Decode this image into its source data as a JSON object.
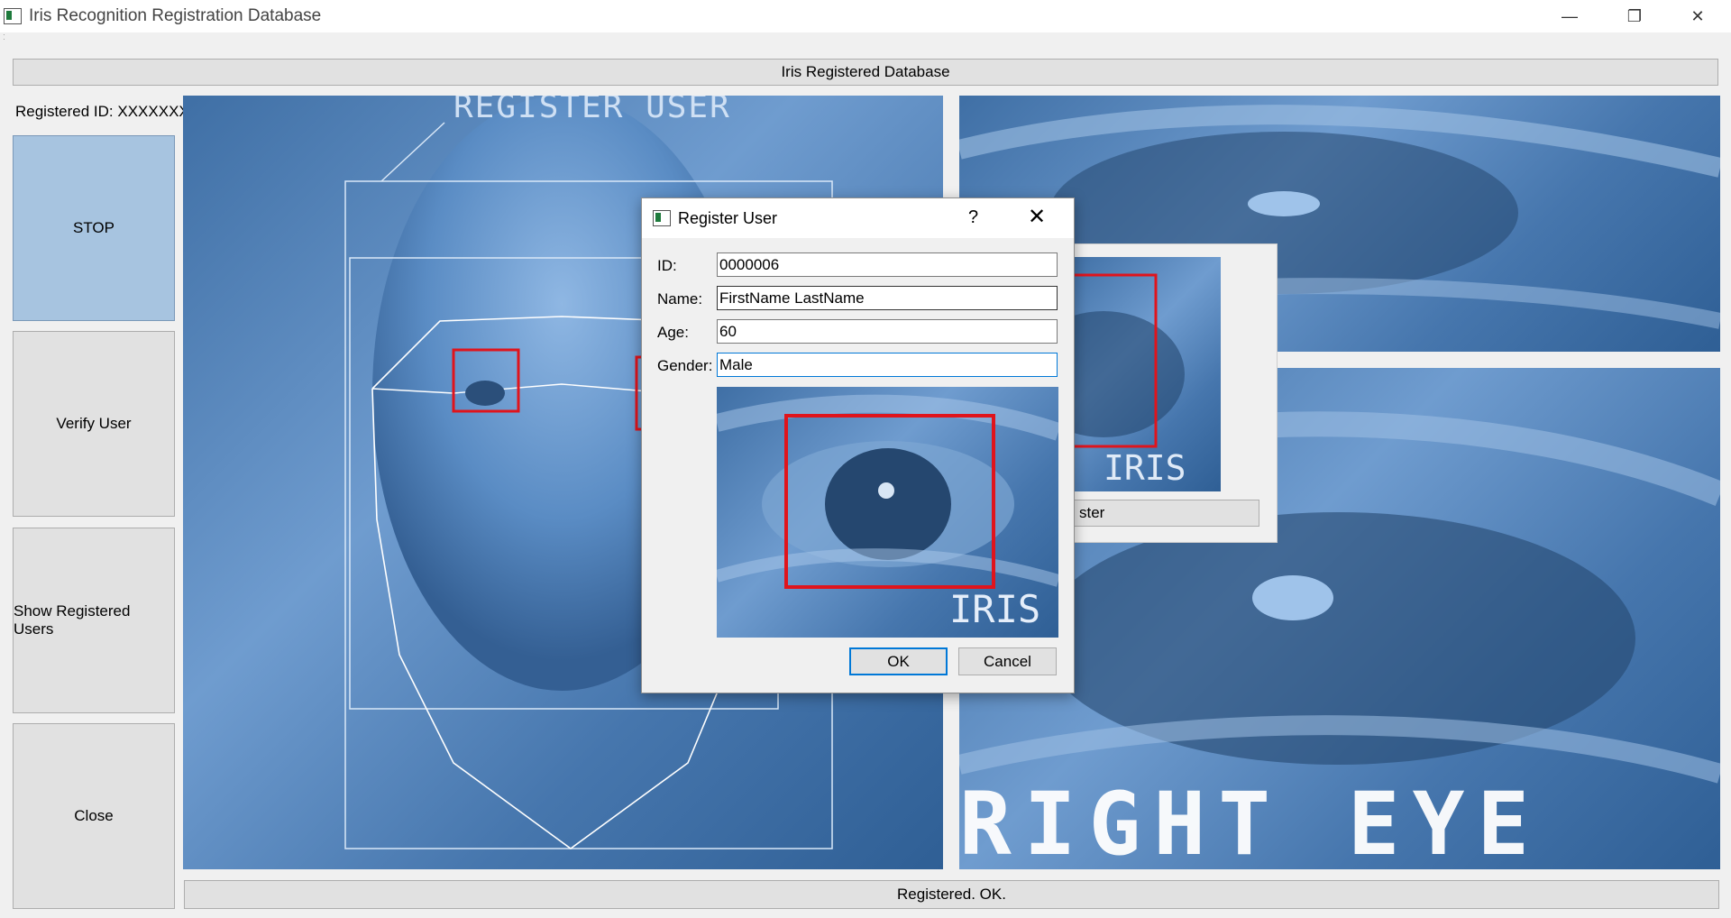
{
  "window": {
    "title": "Iris Recognition Registration Database",
    "minimize_glyph": "—",
    "maximize_glyph": "❐",
    "close_glyph": "✕"
  },
  "header_button": "Iris Registered Database",
  "registered_id_label": "Registered ID: XXXXXXX",
  "sidebar": {
    "stop": "STOP",
    "verify": "Verify User",
    "show": "Show Registered Users",
    "close": "Close"
  },
  "face_panel": {
    "caption": "REGISTER USER"
  },
  "left_eye_panel": {},
  "right_eye_panel": {
    "caption": "RIGHT EYE"
  },
  "background_dialog": {
    "image_caption": "IRIS",
    "button_label": "ster"
  },
  "status_bar": "Registered. OK.",
  "modal": {
    "title": "Register User",
    "help_glyph": "?",
    "close_glyph": "✕",
    "fields": {
      "id_label": "ID:",
      "id_value": "0000006",
      "name_label": "Name:",
      "name_value": "FirstName LastName",
      "age_label": "Age:",
      "age_value": "60",
      "gender_label": "Gender:",
      "gender_value": "Male"
    },
    "image_caption": "IRIS",
    "ok": "OK",
    "cancel": "Cancel"
  },
  "colors": {
    "stop_button": "#a7c4e0",
    "image_blue": "#4f7fb5",
    "highlight_box": "#e0141c",
    "default_button_border": "#0078d7"
  },
  "icons": [
    "app-icon",
    "minimize-icon",
    "maximize-icon",
    "close-icon",
    "help-icon"
  ]
}
